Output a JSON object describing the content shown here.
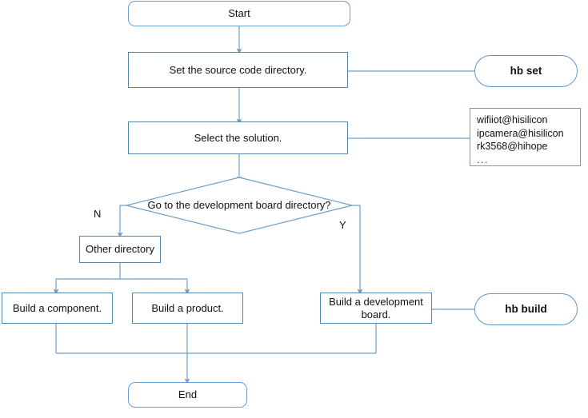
{
  "diagram": {
    "title": "Build process flowchart",
    "colors": {
      "terminator_border": "#6a9fd0",
      "process_border": "#5587ab",
      "capsule_border": "#5b95cd",
      "note_border": "#6f9cc0",
      "connector": "#6e9fc8",
      "background": "#ffffff",
      "text": "#111111"
    },
    "nodes": {
      "start": {
        "label": "Start",
        "shape": "terminator"
      },
      "set_source": {
        "label": "Set the source code directory.",
        "shape": "process"
      },
      "select_solution": {
        "label": "Select the solution.",
        "shape": "process"
      },
      "decision": {
        "label": "Go to the development board directory?",
        "shape": "diamond"
      },
      "other_directory": {
        "label": "Other directory",
        "shape": "process"
      },
      "build_component": {
        "label": "Build a component.",
        "shape": "process"
      },
      "build_product": {
        "label": "Build a product.",
        "shape": "process"
      },
      "build_board": {
        "label": "Build a development board.",
        "shape": "process"
      },
      "end": {
        "label": "End",
        "shape": "terminator"
      }
    },
    "commands": {
      "hb_set": {
        "label": "hb set",
        "shape": "capsule"
      },
      "hb_build": {
        "label": "hb build",
        "shape": "capsule"
      }
    },
    "note_solutions": {
      "lines": [
        "wifiiot@hisilicon",
        "ipcamera@hisilicon",
        "rk3568@hihope"
      ],
      "ellipsis": "..."
    },
    "branch_labels": {
      "no": "N",
      "yes": "Y"
    }
  }
}
